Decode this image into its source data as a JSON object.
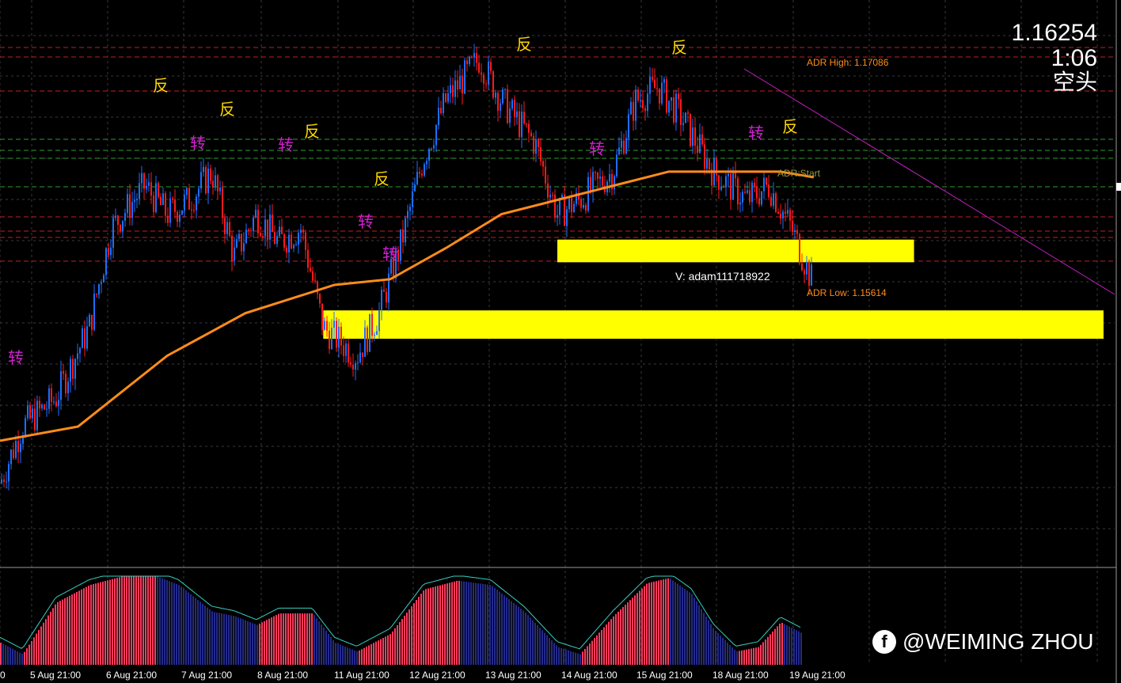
{
  "header": {
    "price": "1.16254",
    "timer": "1:06",
    "trend": "空头"
  },
  "labels": {
    "adr_high": "ADR High: 1.17086",
    "adr_low": "ADR Low: 1.15614",
    "adr_start": "ADR:Start",
    "version": "V: adam111718922"
  },
  "watermark": {
    "icon": "facebook-icon",
    "text": "@WEIMING ZHOU"
  },
  "signals": [
    {
      "text": "转",
      "color": "#d020d0"
    },
    {
      "text": "反",
      "color": "#ffd700"
    },
    {
      "text": "转",
      "color": "#d020d0"
    },
    {
      "text": "反",
      "color": "#ffd700"
    },
    {
      "text": "转",
      "color": "#d020d0"
    },
    {
      "text": "反",
      "color": "#ffd700"
    },
    {
      "text": "转",
      "color": "#d020d0"
    },
    {
      "text": "转",
      "color": "#d020d0"
    },
    {
      "text": "反",
      "color": "#ffd700"
    },
    {
      "text": "反",
      "color": "#ffd700"
    },
    {
      "text": "转",
      "color": "#d020d0"
    },
    {
      "text": "反",
      "color": "#ffd700"
    },
    {
      "text": "转",
      "color": "#d020d0"
    },
    {
      "text": "反",
      "color": "#ffd700"
    }
  ],
  "colors": {
    "background": "#000000",
    "bull_candle": "#1e6fff",
    "bear_candle": "#ff1a1a",
    "moving_average": "#ff8c1a",
    "zone": "#ffff00",
    "trendline": "#c020c0",
    "osc_bull": "#ff3b5c",
    "osc_bear": "#232a8a",
    "grid": "#3a3a3a"
  },
  "chart_data": {
    "type": "line",
    "x_tick_labels": [
      "0",
      "5 Aug 21:00",
      "6 Aug 21:00",
      "7 Aug 21:00",
      "8 Aug 21:00",
      "11 Aug 21:00",
      "12 Aug 21:00",
      "13 Aug 21:00",
      "14 Aug 21:00",
      "15 Aug 21:00",
      "18 Aug 21:00",
      "19 Aug 21:00"
    ],
    "price_path": [
      {
        "t": 0,
        "p": 1.1555
      },
      {
        "t": 0.02,
        "p": 1.1575
      },
      {
        "t": 0.05,
        "p": 1.1585
      },
      {
        "t": 0.08,
        "p": 1.161
      },
      {
        "t": 0.1,
        "p": 1.1645
      },
      {
        "t": 0.13,
        "p": 1.166
      },
      {
        "t": 0.15,
        "p": 1.165
      },
      {
        "t": 0.17,
        "p": 1.1655
      },
      {
        "t": 0.19,
        "p": 1.1665
      },
      {
        "t": 0.21,
        "p": 1.1635
      },
      {
        "t": 0.23,
        "p": 1.165
      },
      {
        "t": 0.25,
        "p": 1.164
      },
      {
        "t": 0.27,
        "p": 1.1645
      },
      {
        "t": 0.29,
        "p": 1.161
      },
      {
        "t": 0.32,
        "p": 1.16
      },
      {
        "t": 0.34,
        "p": 1.1615
      },
      {
        "t": 0.36,
        "p": 1.164
      },
      {
        "t": 0.38,
        "p": 1.167
      },
      {
        "t": 0.4,
        "p": 1.169
      },
      {
        "t": 0.43,
        "p": 1.1705
      },
      {
        "t": 0.45,
        "p": 1.169
      },
      {
        "t": 0.48,
        "p": 1.1675
      },
      {
        "t": 0.5,
        "p": 1.165
      },
      {
        "t": 0.52,
        "p": 1.1655
      },
      {
        "t": 0.55,
        "p": 1.1665
      },
      {
        "t": 0.57,
        "p": 1.169
      },
      {
        "t": 0.59,
        "p": 1.1695
      },
      {
        "t": 0.61,
        "p": 1.1685
      },
      {
        "t": 0.64,
        "p": 1.1665
      },
      {
        "t": 0.67,
        "p": 1.1655
      },
      {
        "t": 0.69,
        "p": 1.166
      },
      {
        "t": 0.71,
        "p": 1.1645
      },
      {
        "t": 0.73,
        "p": 1.1625
      }
    ],
    "moving_average": [
      {
        "t": 0,
        "p": 1.157
      },
      {
        "t": 0.07,
        "p": 1.1575
      },
      {
        "t": 0.15,
        "p": 1.16
      },
      {
        "t": 0.22,
        "p": 1.1615
      },
      {
        "t": 0.3,
        "p": 1.1625
      },
      {
        "t": 0.35,
        "p": 1.1627
      },
      {
        "t": 0.4,
        "p": 1.1638
      },
      {
        "t": 0.45,
        "p": 1.165
      },
      {
        "t": 0.5,
        "p": 1.1655
      },
      {
        "t": 0.55,
        "p": 1.166
      },
      {
        "t": 0.6,
        "p": 1.1665
      },
      {
        "t": 0.65,
        "p": 1.1665
      },
      {
        "t": 0.7,
        "p": 1.1665
      },
      {
        "t": 0.73,
        "p": 1.1663
      }
    ],
    "zones": [
      {
        "from_t": 0.5,
        "to_t": 0.82,
        "p_low": 1.1633,
        "p_high": 1.1641
      },
      {
        "from_t": 0.29,
        "to_t": 0.99,
        "p_low": 1.1606,
        "p_high": 1.1616
      }
    ],
    "levels": {
      "adr_high": 1.17086,
      "adr_low": 1.15614
    },
    "oscillator": [
      {
        "t": 0,
        "v": 25
      },
      {
        "t": 0.02,
        "v": 12
      },
      {
        "t": 0.05,
        "v": 70
      },
      {
        "t": 0.08,
        "v": 90
      },
      {
        "t": 0.11,
        "v": 100
      },
      {
        "t": 0.14,
        "v": 100
      },
      {
        "t": 0.16,
        "v": 90
      },
      {
        "t": 0.19,
        "v": 60
      },
      {
        "t": 0.21,
        "v": 55
      },
      {
        "t": 0.23,
        "v": 45
      },
      {
        "t": 0.25,
        "v": 58
      },
      {
        "t": 0.28,
        "v": 58
      },
      {
        "t": 0.3,
        "v": 25
      },
      {
        "t": 0.32,
        "v": 15
      },
      {
        "t": 0.35,
        "v": 35
      },
      {
        "t": 0.38,
        "v": 85
      },
      {
        "t": 0.41,
        "v": 95
      },
      {
        "t": 0.44,
        "v": 90
      },
      {
        "t": 0.47,
        "v": 60
      },
      {
        "t": 0.5,
        "v": 20
      },
      {
        "t": 0.52,
        "v": 12
      },
      {
        "t": 0.55,
        "v": 55
      },
      {
        "t": 0.58,
        "v": 92
      },
      {
        "t": 0.6,
        "v": 98
      },
      {
        "t": 0.62,
        "v": 80
      },
      {
        "t": 0.64,
        "v": 40
      },
      {
        "t": 0.66,
        "v": 15
      },
      {
        "t": 0.68,
        "v": 20
      },
      {
        "t": 0.7,
        "v": 48
      },
      {
        "t": 0.72,
        "v": 35
      }
    ]
  }
}
